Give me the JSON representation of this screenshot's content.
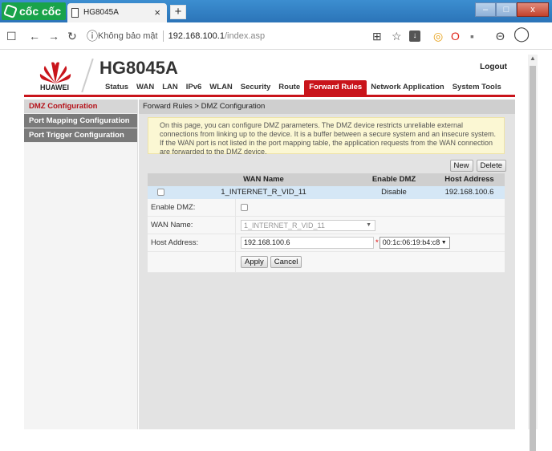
{
  "browser": {
    "brand": "cốc cốc",
    "tab_title": "HG8045A",
    "tab_close": "×",
    "new_tab": "+",
    "security_label": "Không bảo mật",
    "url_host": "192.168.100.1",
    "url_path": "/index.asp",
    "window_buttons": {
      "minimize": "–",
      "maximize": "□",
      "close": "x"
    }
  },
  "router": {
    "brand": "HUAWEI",
    "model": "HG8045A",
    "logout": "Logout",
    "nav": [
      "Status",
      "WAN",
      "LAN",
      "IPv6",
      "WLAN",
      "Security",
      "Route",
      "Forward Rules",
      "Network Application",
      "System Tools"
    ],
    "nav_active": "Forward Rules",
    "sidebar": [
      "DMZ Configuration",
      "Port Mapping Configuration",
      "Port Trigger Configuration"
    ],
    "breadcrumb": "Forward Rules > DMZ Configuration",
    "note": "On this page, you can configure DMZ parameters. The DMZ device restricts unreliable external connections from linking up to the device. It is a buffer between a secure system and an insecure system. If the WAN port is not listed in the port mapping table, the application requests from the WAN connection are forwarded to the DMZ device.",
    "buttons": {
      "new": "New",
      "delete": "Delete",
      "apply": "Apply",
      "cancel": "Cancel"
    },
    "table": {
      "headers": [
        "",
        "WAN Name",
        "Enable DMZ",
        "Host Address"
      ],
      "rows": [
        {
          "wan_name": "1_INTERNET_R_VID_11",
          "enable_dmz": "Disable",
          "host": "192.168.100.6"
        }
      ]
    },
    "form": {
      "enable_label": "Enable DMZ:",
      "wan_label": "WAN Name:",
      "wan_value": "1_INTERNET_R_VID_11",
      "host_label": "Host Address:",
      "host_value": "192.168.100.6",
      "required_mark": "*",
      "mac_value": "00:1c:06:19:b4:c8"
    }
  },
  "colors": {
    "accent": "#c9141b",
    "titlebar": "#2b74b8",
    "brand_green": "#19a34a",
    "note_bg": "#fbf7d3",
    "selected_row": "#d5e7f6"
  }
}
